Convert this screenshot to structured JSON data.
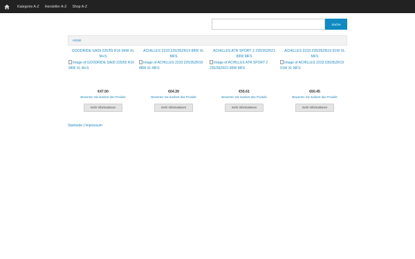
{
  "nav": {
    "items": [
      "Kategorie A-Z",
      "Hersteller A-Z",
      "Shop A-Z"
    ]
  },
  "search": {
    "placeholder": "",
    "button_label": "Suche"
  },
  "breadcrumb": {
    "home_label": "HOME"
  },
  "products": [
    {
      "title": "GOODRIDE SA09 225/55 R16 94W XL M+S",
      "image_alt": "Image of GOODRIDE SA09 225/55 R16 94W XL M+S",
      "price": "€47.50",
      "review_label": "Bewerten Sie äusbert das Produkt",
      "more_label": "mehr Informationen"
    },
    {
      "title": "ACHILLES 2233 225/35ZR19 88W XL MFS",
      "image_alt": "Image of ACHILLES 2233 225/35ZR19 88W XL MFS",
      "price": "€64.39",
      "review_label": "Bewerten Sie äusbert das Produkt",
      "more_label": "mehr Informationen"
    },
    {
      "title": "ACHILLES ATR SPORT 2 235/35ZR21 89W MFS",
      "image_alt": "Image of ACHILLES ATR SPORT 2 235/35ZR21 89W MFS",
      "price": "€55.61",
      "review_label": "Bewerten Sie äusbert das Produkt",
      "more_label": "mehr Informationen"
    },
    {
      "title": "ACHILLES 2233 235/35ZR19 91W XL MFS",
      "image_alt": "Image of ACHILLES 2233 235/35ZR19 91W XL MFS",
      "price": "€60.45",
      "review_label": "Bewerten Sie äusbert das Produkt",
      "more_label": "mehr Informationen"
    }
  ],
  "footer": {
    "home_link": "Startseite",
    "separator": "|",
    "imprint_link": "Impressum"
  },
  "colors": {
    "topbar": "#222222",
    "accent": "#0f8bc2",
    "link": "#1e88be"
  },
  "icons": {
    "home": "home-icon",
    "broken_image": "broken-image-icon"
  }
}
